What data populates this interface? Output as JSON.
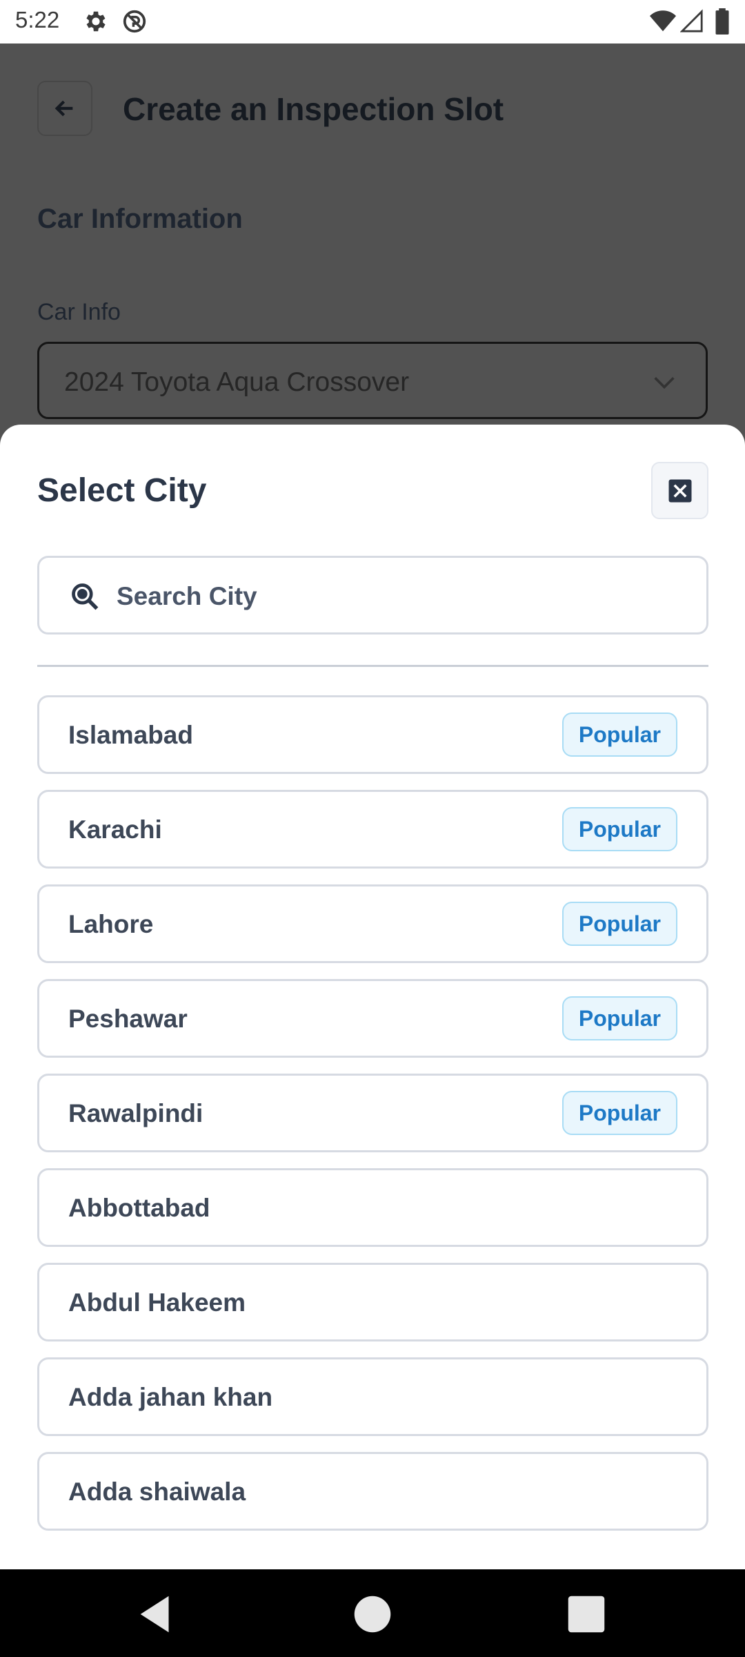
{
  "status_bar": {
    "time": "5:22",
    "icons": [
      "gear-icon",
      "dnd-icon",
      "wifi-icon",
      "signal-icon",
      "battery-icon"
    ]
  },
  "page": {
    "title": "Create an Inspection Slot",
    "back_icon": "arrow-left-icon",
    "section_title": "Car Information",
    "car_info_label": "Car Info",
    "car_info_value": "2024 Toyota Aqua Crossover"
  },
  "sheet": {
    "title": "Select City",
    "close_icon": "close-icon",
    "search_placeholder": "Search City",
    "cities": [
      {
        "name": "Islamabad",
        "badge": "Popular"
      },
      {
        "name": "Karachi",
        "badge": "Popular"
      },
      {
        "name": "Lahore",
        "badge": "Popular"
      },
      {
        "name": "Peshawar",
        "badge": "Popular"
      },
      {
        "name": "Rawalpindi",
        "badge": "Popular"
      },
      {
        "name": "Abbottabad"
      },
      {
        "name": "Abdul Hakeem"
      },
      {
        "name": "Adda jahan khan"
      },
      {
        "name": "Adda shaiwala"
      }
    ]
  },
  "colors": {
    "badge_text": "#1d79c6",
    "badge_bg": "#e9f6fd",
    "overlay": "#525252"
  }
}
